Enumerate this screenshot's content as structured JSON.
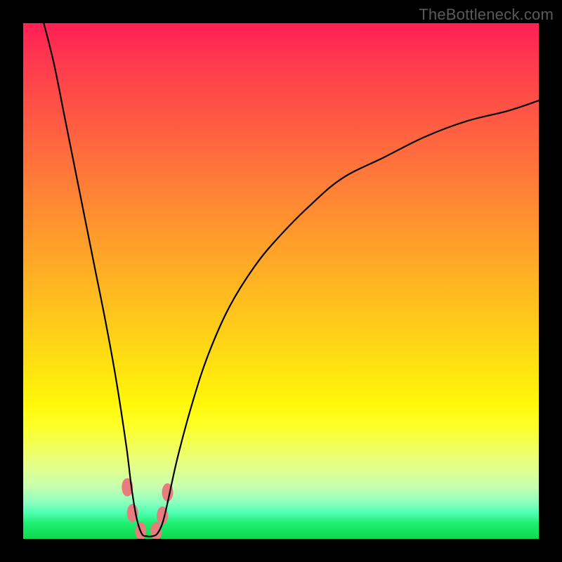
{
  "watermark": "TheBottleneck.com",
  "chart_data": {
    "type": "line",
    "title": "",
    "xlabel": "",
    "ylabel": "",
    "xlim": [
      0,
      100
    ],
    "ylim": [
      0,
      100
    ],
    "series": [
      {
        "name": "bottleneck-curve",
        "x": [
          4,
          6,
          8,
          10,
          12,
          14,
          16,
          18,
          20,
          21,
          22,
          23,
          24,
          25,
          26,
          27,
          28,
          30,
          33,
          36,
          40,
          45,
          50,
          56,
          62,
          70,
          78,
          86,
          94,
          100
        ],
        "values": [
          100,
          92,
          82,
          72,
          62,
          52,
          42,
          31,
          18,
          10,
          4,
          1,
          0.5,
          0.5,
          1,
          3,
          7,
          16,
          27,
          36,
          45,
          53,
          59,
          65,
          70,
          74,
          78,
          81,
          83,
          85
        ]
      }
    ],
    "markers": [
      {
        "x": 20.2,
        "y": 10.0
      },
      {
        "x": 21.2,
        "y": 5.0
      },
      {
        "x": 22.8,
        "y": 1.5
      },
      {
        "x": 25.8,
        "y": 1.5
      },
      {
        "x": 27.0,
        "y": 4.5
      },
      {
        "x": 28.0,
        "y": 9.0
      }
    ],
    "marker_style": {
      "color": "#e77d7d",
      "rx": 8,
      "ry": 13
    }
  }
}
